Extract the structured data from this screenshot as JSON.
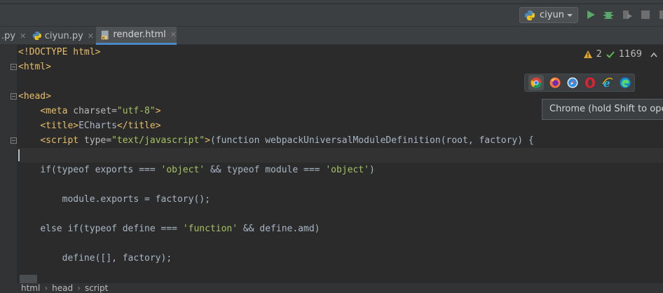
{
  "toolbar": {
    "run_config_label": "ciyun"
  },
  "tabs": [
    {
      "label": ".py",
      "active": false
    },
    {
      "label": "ciyun.py",
      "active": false
    },
    {
      "label": "render.html",
      "active": true
    }
  ],
  "tab_close_glyph": "✕",
  "inspections": {
    "warnings": "2",
    "ok_count": "1169"
  },
  "browsers": [
    "chrome-icon",
    "firefox-icon",
    "safari-icon",
    "opera-icon",
    "ie-icon",
    "edge-icon"
  ],
  "tooltip": "Chrome (hold Shift to open",
  "code": {
    "l1": "<!DOCTYPE html>",
    "l2": "<html>",
    "l4": "<head>",
    "l5_tag": "<meta ",
    "l5_attr": "charset=",
    "l5_str": "\"utf-8\"",
    "l5_end": ">",
    "l6_open": "<title>",
    "l6_txt": "ECharts",
    "l6_close": "</title>",
    "l7_tag": "<script ",
    "l7_attr": "type=",
    "l7_str": "\"text/javascript\"",
    "l7_end": ">",
    "l7_rest": "(function webpackUniversalModuleDefinition(root, factory) {",
    "l9_a": "if(typeof exports === ",
    "l9_s1": "'object'",
    "l9_b": " && typeof module === ",
    "l9_s2": "'object'",
    "l9_c": ")",
    "l11": "module.exports = factory();",
    "l13_a": "else if(typeof define === ",
    "l13_s": "'function'",
    "l13_b": " && define.amd)",
    "l15": "define([], factory);"
  },
  "breadcrumbs": [
    "html",
    "head",
    "script"
  ],
  "breadcrumb_sep": "›",
  "colors": {
    "background": "#2b2b2b",
    "tag": "#e8bf6a",
    "string": "#a5c261",
    "accent": "#4a88c7"
  }
}
